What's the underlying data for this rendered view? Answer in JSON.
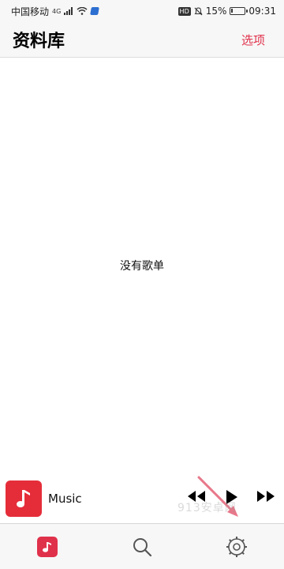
{
  "status_bar": {
    "carrier": "中国移动",
    "network": "4G",
    "battery": "15%",
    "battery_level": 0.15,
    "time": "09:31"
  },
  "header": {
    "title": "资料库",
    "options_label": "选项"
  },
  "main": {
    "empty_message": "没有歌单"
  },
  "now_playing": {
    "title": "Music",
    "artwork_icon": "music-note-icon",
    "controls": [
      "previous-icon",
      "play-icon",
      "next-icon"
    ]
  },
  "tabbar": {
    "tabs": [
      {
        "name": "library",
        "icon": "music-library-icon",
        "active": true
      },
      {
        "name": "search",
        "icon": "search-icon",
        "active": false
      },
      {
        "name": "settings",
        "icon": "gear-icon",
        "active": false
      }
    ]
  },
  "overlay": {
    "watermark": "913安卓网"
  },
  "colors": {
    "accent": "#e0314b",
    "artwork_bg": "#e52d3a"
  }
}
